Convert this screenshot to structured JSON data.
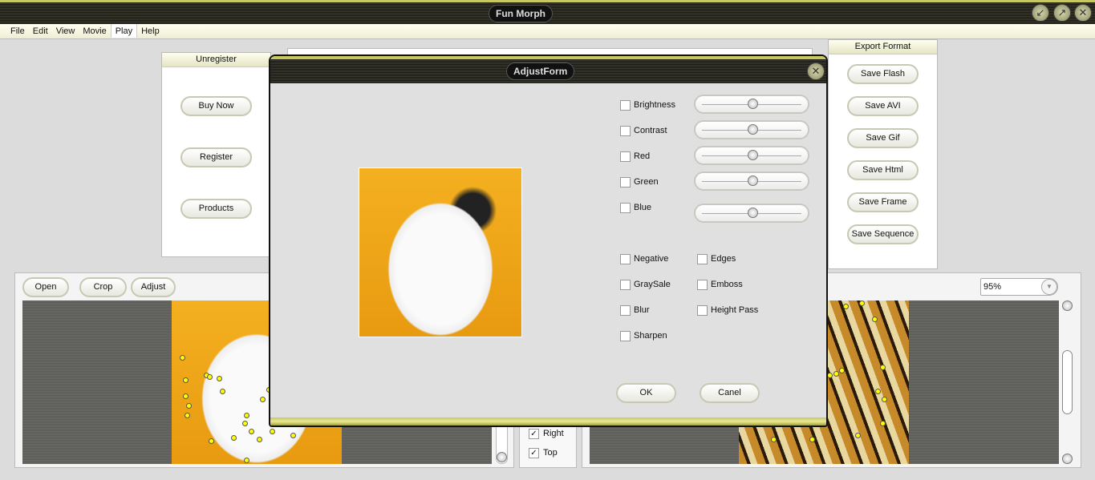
{
  "app": {
    "title": "Fun Morph",
    "window_buttons": [
      "minimize-icon",
      "maximize-icon",
      "close-icon"
    ]
  },
  "menu": [
    "File",
    "Edit",
    "View",
    "Movie",
    "Play",
    "Help"
  ],
  "menu_active": "Play",
  "unregister": {
    "title": "Unregister",
    "buttons": [
      "Buy Now",
      "Register",
      "Products"
    ]
  },
  "export": {
    "title": "Export Format",
    "buttons": [
      "Save Flash",
      "Save AVI",
      "Save Gif",
      "Save Html",
      "Save Frame",
      "Save Sequence"
    ]
  },
  "left_panel": {
    "buttons": [
      "Open",
      "Crop",
      "Adjust"
    ]
  },
  "middle_panel": {
    "checks": [
      {
        "label": "Right",
        "checked": true
      },
      {
        "label": "Top",
        "checked": true
      }
    ]
  },
  "right_panel": {
    "zoom": "95%"
  },
  "dialog": {
    "title": "AdjustForm",
    "adjustments": [
      {
        "label": "Brightness",
        "value": 50
      },
      {
        "label": "Contrast",
        "value": 50
      },
      {
        "label": "Red",
        "value": 50
      },
      {
        "label": "Green",
        "value": 50
      },
      {
        "label": "Blue",
        "value": 50
      }
    ],
    "filters_col1": [
      "Negative",
      "GraySale",
      "Blur",
      "Sharpen"
    ],
    "filters_col2": [
      "Edges",
      "Emboss",
      "Height Pass"
    ],
    "ok": "OK",
    "cancel": "Canel"
  },
  "colors": {
    "accent": "#c8c860",
    "titlebar": "#2a2a22",
    "background": "#dcdcdc",
    "marker": "#ffff00"
  }
}
